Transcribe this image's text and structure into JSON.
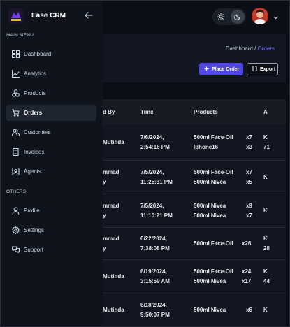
{
  "brand": {
    "name": "Ease CRM"
  },
  "sidebar": {
    "main_menu_label": "MAIN MENU",
    "others_label": "OTHERS",
    "items": [
      {
        "label": "Dashboard",
        "icon": "dashboard-icon"
      },
      {
        "label": "Analytics",
        "icon": "analytics-icon"
      },
      {
        "label": "Products",
        "icon": "products-icon"
      },
      {
        "label": "Orders",
        "icon": "cart-icon",
        "active": true
      },
      {
        "label": "Customers",
        "icon": "customers-icon"
      },
      {
        "label": "Invoices",
        "icon": "invoices-icon"
      },
      {
        "label": "Agents",
        "icon": "agents-icon"
      }
    ],
    "others": [
      {
        "label": "Profile",
        "icon": "profile-icon"
      },
      {
        "label": "Settings",
        "icon": "settings-icon"
      },
      {
        "label": "Support",
        "icon": "support-icon"
      }
    ]
  },
  "breadcrumb": {
    "parent": "Dashboard /",
    "current": "Orders"
  },
  "actions": {
    "place_order": "Place Order",
    "export": "Export"
  },
  "table": {
    "columns": {
      "placed_by": "d By",
      "time": "Time",
      "products": "Products",
      "amount": "A"
    },
    "rows": [
      {
        "placed_by": [
          "Mutinda",
          ""
        ],
        "date": "7/6/2024,",
        "time": "2:54:16 PM",
        "products": [
          "500ml Face-Oil",
          "Iphone16"
        ],
        "qty": [
          "x7",
          "x3"
        ],
        "amount": [
          "K",
          "71"
        ]
      },
      {
        "placed_by": [
          "mmad",
          "y"
        ],
        "date": "7/5/2024,",
        "time": "11:25:31 PM",
        "products": [
          "500ml Face-Oil",
          "500ml Nivea"
        ],
        "qty": [
          "x7",
          "x5"
        ],
        "amount": [
          "K",
          ""
        ]
      },
      {
        "placed_by": [
          "mmad",
          "y"
        ],
        "date": "7/5/2024,",
        "time": "11:10:21 PM",
        "products": [
          "500ml Nivea",
          "500ml Nivea"
        ],
        "qty": [
          "x9",
          "x7"
        ],
        "amount": [
          "K",
          ""
        ]
      },
      {
        "placed_by": [
          "mmad",
          "y"
        ],
        "date": "6/22/2024,",
        "time": "7:38:08 PM",
        "products": [
          "500ml Face-Oil",
          ""
        ],
        "qty": [
          "x26",
          ""
        ],
        "amount": [
          "K",
          "28"
        ]
      },
      {
        "placed_by": [
          "Mutinda",
          ""
        ],
        "date": "6/19/2024,",
        "time": "3:15:59 AM",
        "products": [
          "500ml Face-Oil",
          "500ml Nivea"
        ],
        "qty": [
          "x24",
          "x17"
        ],
        "amount": [
          "K",
          "44"
        ]
      },
      {
        "placed_by": [
          "Mutinda",
          ""
        ],
        "date": "6/18/2024,",
        "time": "9:50:07 PM",
        "products": [
          "500ml Nivea",
          ""
        ],
        "qty": [
          "x6",
          ""
        ],
        "amount": [
          "K",
          ""
        ]
      }
    ]
  },
  "colors": {
    "accent": "#4f46e5",
    "active_link": "#6f6bff",
    "sidebar_bg": "#0f131b",
    "page_bg": "#0b0e14"
  }
}
